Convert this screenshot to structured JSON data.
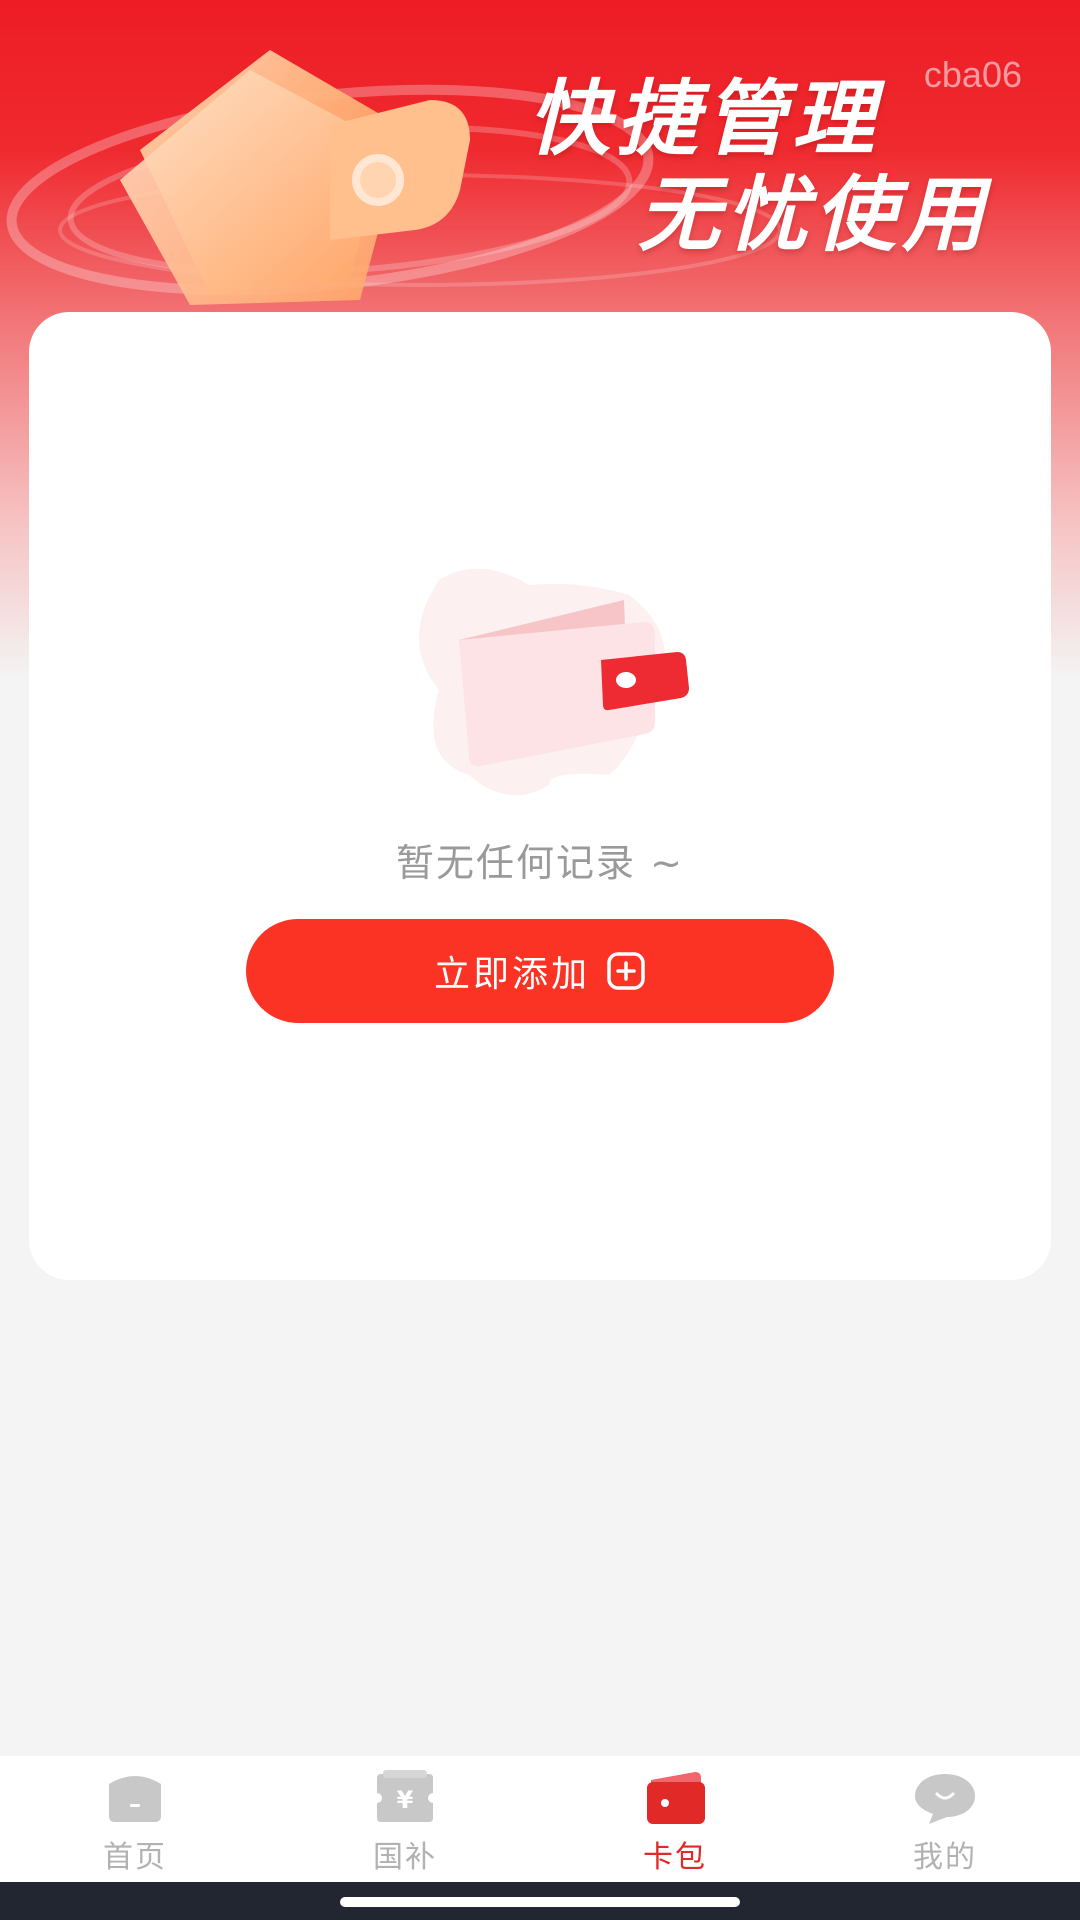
{
  "banner": {
    "slogan_line1": "快捷管理",
    "slogan_line2": "无忧使用",
    "env_tag": "cba06",
    "illustration_icon": "wallet-3d-icon"
  },
  "empty_state": {
    "illustration_icon": "empty-wallet-icon",
    "message": "暂无任何记录 ~",
    "add_button_label": "立即添加",
    "add_button_icon": "plus-square-icon"
  },
  "tabbar": {
    "tabs": [
      {
        "label": "首页",
        "icon": "home-icon",
        "active": false
      },
      {
        "label": "国补",
        "icon": "yen-ticket-icon",
        "active": false
      },
      {
        "label": "卡包",
        "icon": "wallet-icon",
        "active": true
      },
      {
        "label": "我的",
        "icon": "chat-bubble-icon",
        "active": false
      }
    ]
  },
  "colors": {
    "brand_red": "#ee1c25",
    "button_red": "#fb3324",
    "active_tab": "#e12a27",
    "inactive_tab": "#b2b2b2",
    "page_bg": "#f4f4f4"
  }
}
